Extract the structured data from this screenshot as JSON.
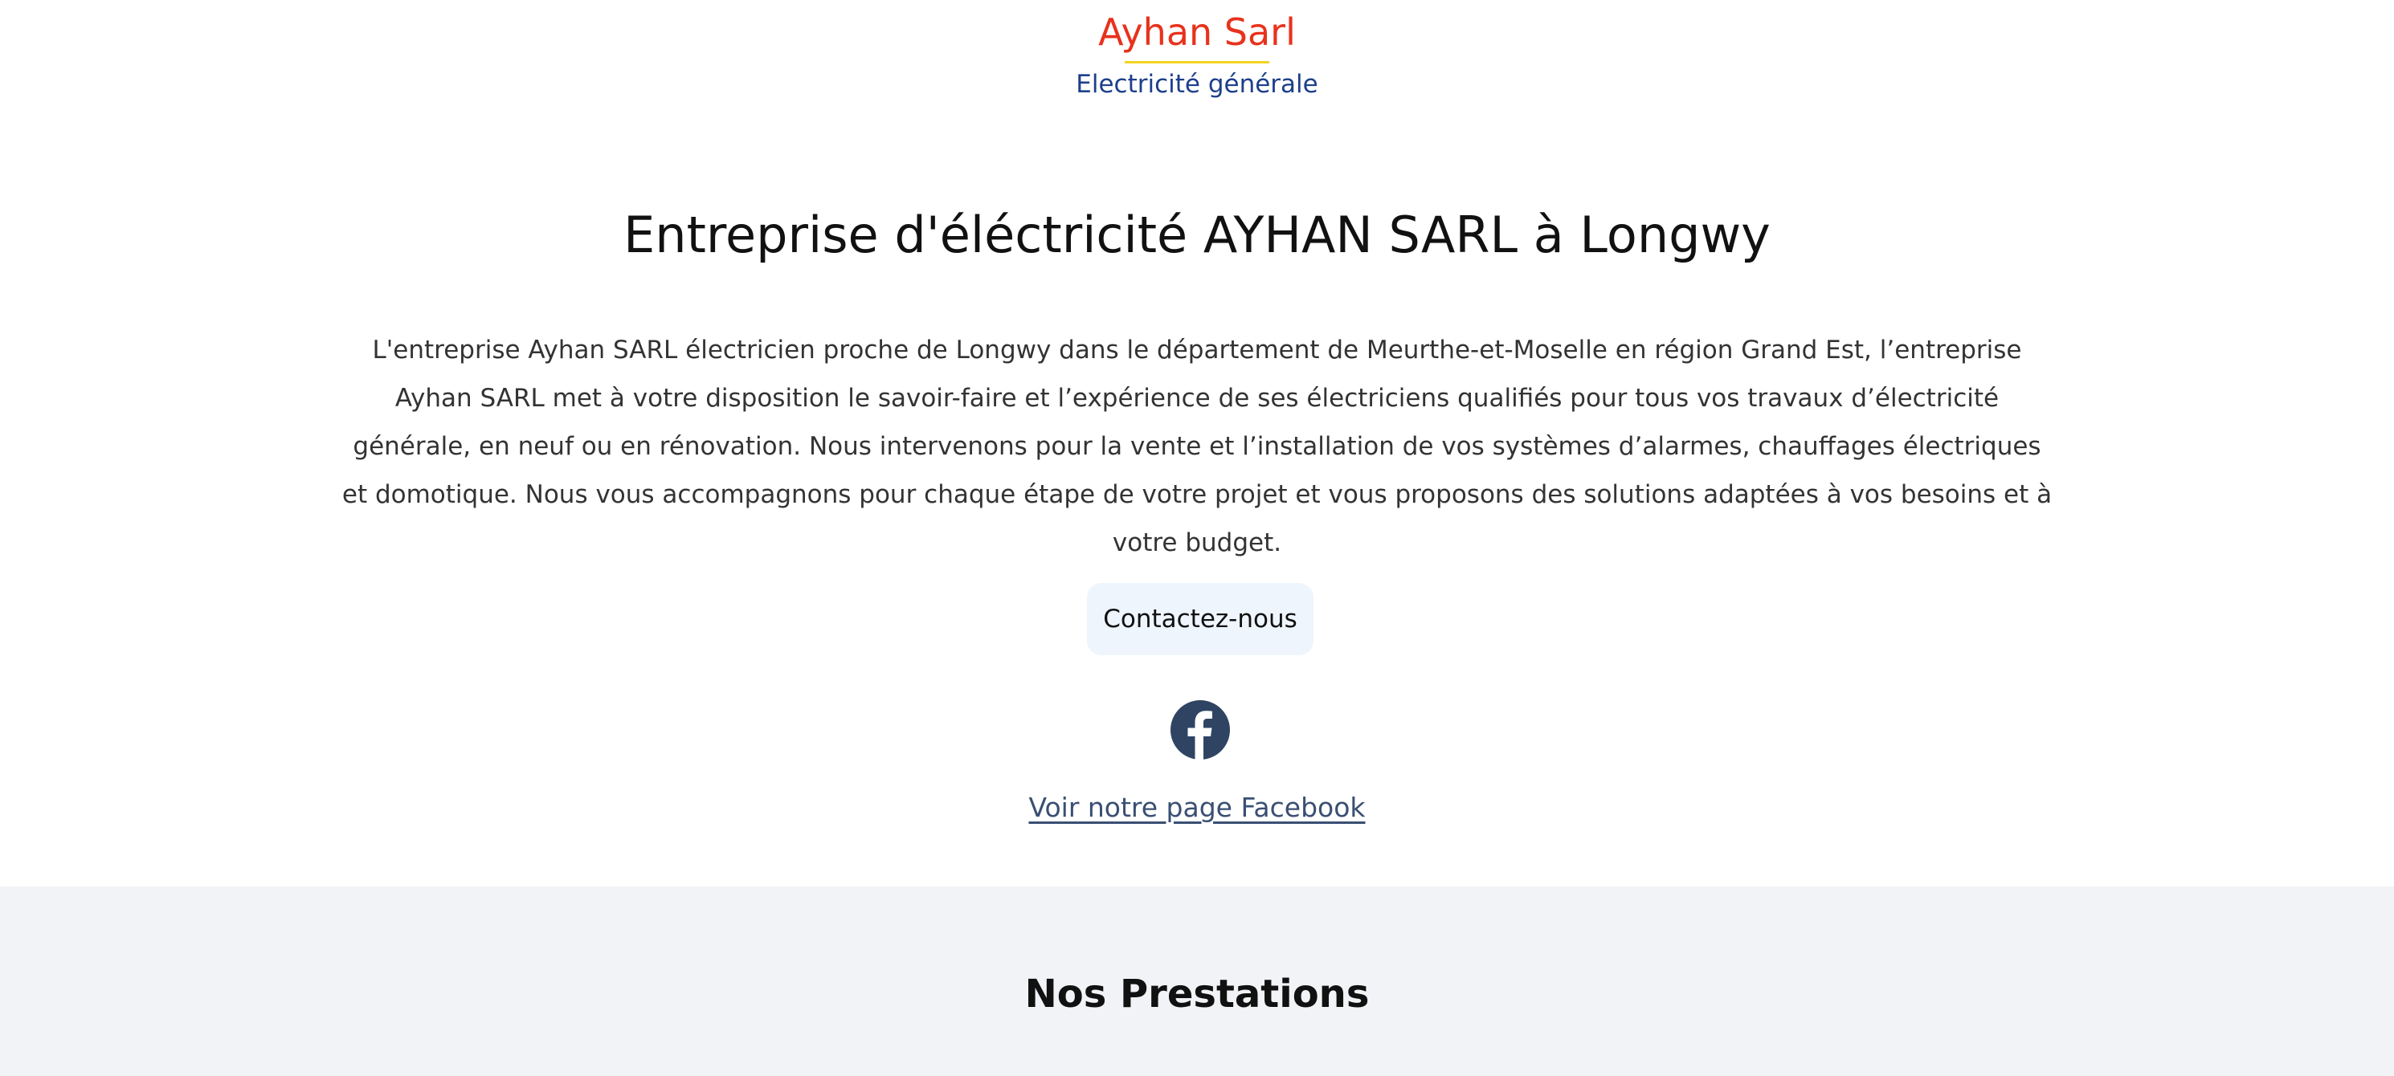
{
  "header": {
    "logo_name": "Ayhan Sarl",
    "logo_tagline": "Electricité générale"
  },
  "hero": {
    "title": "Entreprise d'éléctricité AYHAN SARL à Longwy",
    "description": "L'entreprise Ayhan SARL électricien proche de Longwy dans le département de Meurthe-et-Moselle en région Grand Est, l’entreprise Ayhan SARL met à votre disposition le savoir-faire et l’expérience de ses électriciens qualifiés pour tous vos travaux d’électricité générale, en neuf ou en rénovation. Nous intervenons pour la vente et l’installation de vos systèmes d’alarmes, chauffages électriques et domotique. Nous vous accompagnons pour chaque étape de votre projet et vous proposons des solutions adaptées à vos besoins et à votre budget.",
    "contact_label": "Contactez-nous",
    "facebook_icon": "facebook-icon",
    "facebook_link_label": "Voir notre page Facebook"
  },
  "services": {
    "title": "Nos Prestations"
  },
  "colors": {
    "logo_name": "#e8321c",
    "logo_rule": "#f5d41e",
    "logo_tagline": "#1d3f8b",
    "button_bg": "#eef5fd",
    "facebook_icon": "#2f4463",
    "link": "#3a4f73",
    "section_bg": "#f2f3f6"
  }
}
